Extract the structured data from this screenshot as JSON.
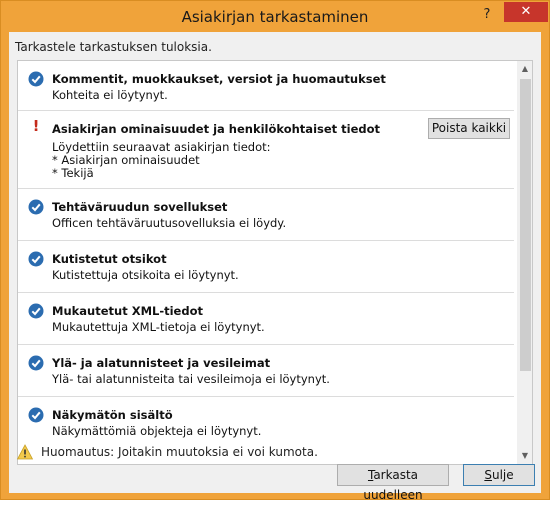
{
  "window": {
    "title": "Asiakirjan tarkastaminen",
    "help": "?",
    "close": "✕"
  },
  "instruction": "Tarkastele tarkastuksen tuloksia.",
  "items": [
    {
      "status": "ok",
      "title": "Kommentit, muokkaukset, versiot ja huomautukset",
      "body": "Kohteita ei löytynyt."
    },
    {
      "status": "warning",
      "title": "Asiakirjan ominaisuudet ja henkilökohtaiset tiedot",
      "body": "Löydettiin seuraavat asiakirjan tiedot:\n* Asiakirjan ominaisuudet\n* Tekijä",
      "action": "Poista kaikki"
    },
    {
      "status": "ok",
      "title": "Tehtäväruudun sovellukset",
      "body": "Officen tehtäväruutusovelluksia ei löydy."
    },
    {
      "status": "ok",
      "title": "Kutistetut otsikot",
      "body": "Kutistettuja otsikoita ei löytynyt."
    },
    {
      "status": "ok",
      "title": "Mukautetut XML-tiedot",
      "body": "Mukautettuja XML-tietoja ei löytynyt."
    },
    {
      "status": "ok",
      "title": "Ylä- ja alatunnisteet ja vesileimat",
      "body": "Ylä- tai alatunnisteita tai vesileimoja ei löytynyt."
    },
    {
      "status": "ok",
      "title": "Näkymätön sisältö",
      "body": "Näkymättömiä objekteja ei löytynyt."
    }
  ],
  "footer": {
    "note": "Huomautus: Joitakin muutoksia ei voi kumota.",
    "recheck_prefix": "T",
    "recheck_rest": "arkasta uudelleen",
    "close_prefix": "S",
    "close_rest": "ulje"
  },
  "colors": {
    "titlebar": "#f0a33a",
    "close": "#c7352b",
    "check": "#2b6cb0",
    "warning": "#c42b1c"
  }
}
